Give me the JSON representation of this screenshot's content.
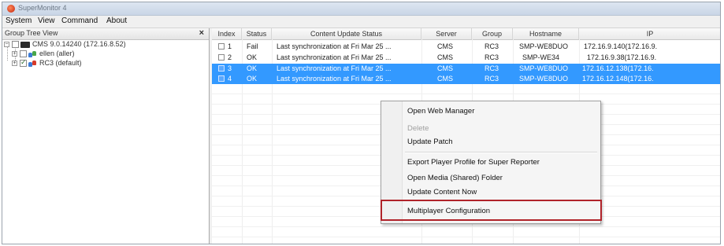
{
  "window": {
    "title": "SuperMonitor 4"
  },
  "menu": [
    "System",
    "View",
    "Command",
    "About"
  ],
  "left_pane": {
    "title": "Group Tree View",
    "close": "×",
    "tree": [
      {
        "label": "CMS  9.0.14240  (172.16.8.52)",
        "checked": false
      },
      {
        "label": "ellen  (aller)",
        "checked": false
      },
      {
        "label": "RC3  (default)",
        "checked": true
      }
    ]
  },
  "table": {
    "columns": [
      "Index",
      "Status",
      "Content Update Status",
      "Server",
      "Group",
      "Hostname",
      "IP"
    ],
    "rows": [
      {
        "index": "1",
        "status": "Fail",
        "update": "Last synchronization at Fri Mar 25 ...",
        "server": "CMS",
        "group": "RC3",
        "hostname": "SMP-WE8DUO",
        "ip": "172.16.9.140(172.16.9.",
        "selected": false
      },
      {
        "index": "2",
        "status": "OK",
        "update": "Last synchronization at Fri Mar 25 ...",
        "server": "CMS",
        "group": "RC3",
        "hostname": "SMP-WE34",
        "ip": "172.16.9.38(172.16.9.",
        "selected": false
      },
      {
        "index": "3",
        "status": "OK",
        "update": "Last synchronization at Fri Mar 25 ...",
        "server": "CMS",
        "group": "RC3",
        "hostname": "SMP-WE8DUO",
        "ip": "172.16.12.138(172.16.",
        "selected": true
      },
      {
        "index": "4",
        "status": "OK",
        "update": "Last synchronization at Fri Mar 25 ...",
        "server": "CMS",
        "group": "RC3",
        "hostname": "SMP-WE8DUO",
        "ip": "172.16.12.148(172.16.",
        "selected": true
      }
    ]
  },
  "context_menu": {
    "items": [
      {
        "label": "Open Web Manager",
        "enabled": true
      },
      {
        "label": "Delete",
        "enabled": false
      },
      {
        "label": "Update Patch",
        "enabled": true
      },
      {
        "label": "Export Player Profile for Super Reporter",
        "enabled": true
      },
      {
        "label": "Open Media (Shared) Folder",
        "enabled": true
      },
      {
        "label": "Update Content Now",
        "enabled": true
      },
      {
        "label": "Multiplayer Configuration",
        "enabled": true,
        "highlighted": true
      }
    ]
  },
  "colors": {
    "selection": "#3399ff",
    "highlight_border": "#b0232a"
  }
}
